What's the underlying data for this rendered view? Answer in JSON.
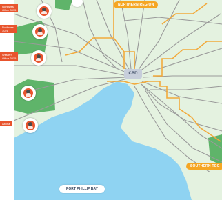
{
  "map": {
    "region_labels": {
      "northern": "NORTHERN REGION",
      "southern": "SOUTHERN REG",
      "cbd": "CBD",
      "bay": "PORT PHILLIP BAY"
    },
    "colors": {
      "land": "#e4f2e0",
      "park": "#5fb46a",
      "water": "#8fd3f2",
      "road": "#9a9a9a",
      "boundary": "#f2a93b",
      "marker": "#e8542d",
      "label_bg": "#f5a623"
    },
    "office_markers": [
      {
        "tag_line1": "Northwest",
        "tag_line2": "Office 3015",
        "icon": "office-pin-icon"
      },
      {
        "tag_line1": "Northwest",
        "tag_line2": "3021",
        "icon": "office-pin-icon"
      },
      {
        "tag_line1": "Western",
        "tag_line2": "Office 3015",
        "icon": "office-pin-icon"
      },
      {
        "tag_line1": "",
        "tag_line2": "",
        "icon": "office-pin-icon"
      },
      {
        "tag_line1": "Altona",
        "tag_line2": "",
        "icon": "office-pin-icon"
      }
    ]
  }
}
